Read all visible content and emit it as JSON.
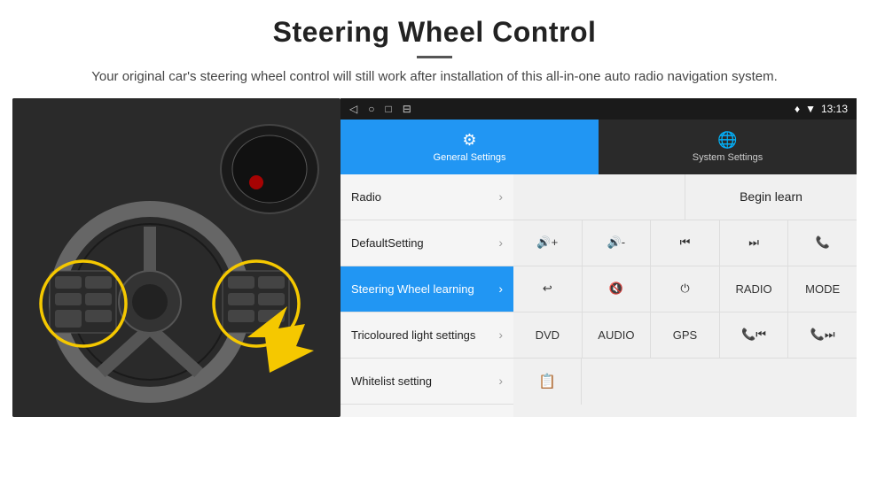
{
  "header": {
    "title": "Steering Wheel Control",
    "description": "Your original car's steering wheel control will still work after installation of this all-in-one auto radio navigation system."
  },
  "status_bar": {
    "back_icon": "◁",
    "home_icon": "○",
    "square_icon": "□",
    "menu_icon": "⊟",
    "location_icon": "♦",
    "signal_icon": "▼",
    "time": "13:13"
  },
  "tabs": [
    {
      "label": "General Settings",
      "icon": "⚙",
      "active": true
    },
    {
      "label": "System Settings",
      "icon": "🌐",
      "active": false
    }
  ],
  "menu_items": [
    {
      "label": "Radio",
      "active": false
    },
    {
      "label": "DefaultSetting",
      "active": false
    },
    {
      "label": "Steering Wheel learning",
      "active": true
    },
    {
      "label": "Tricoloured light settings",
      "active": false
    },
    {
      "label": "Whitelist setting",
      "active": false
    }
  ],
  "buttons": {
    "begin_learn": "Begin learn",
    "row2": [
      "🔊+",
      "🔊-",
      "⏮",
      "⏭",
      "📞"
    ],
    "row2_labels": [
      "vol_up",
      "vol_down",
      "prev",
      "next",
      "phone"
    ],
    "row3": [
      "↩",
      "🔊✕",
      "⏻",
      "RADIO",
      "MODE"
    ],
    "row3_labels": [
      "back",
      "mute",
      "power",
      "radio",
      "mode"
    ],
    "row4": [
      "DVD",
      "AUDIO",
      "GPS",
      "📞⏮",
      "📞⏭"
    ],
    "row4_labels": [
      "dvd",
      "audio",
      "gps",
      "call_prev",
      "call_next"
    ],
    "row5_icon": "📋"
  }
}
